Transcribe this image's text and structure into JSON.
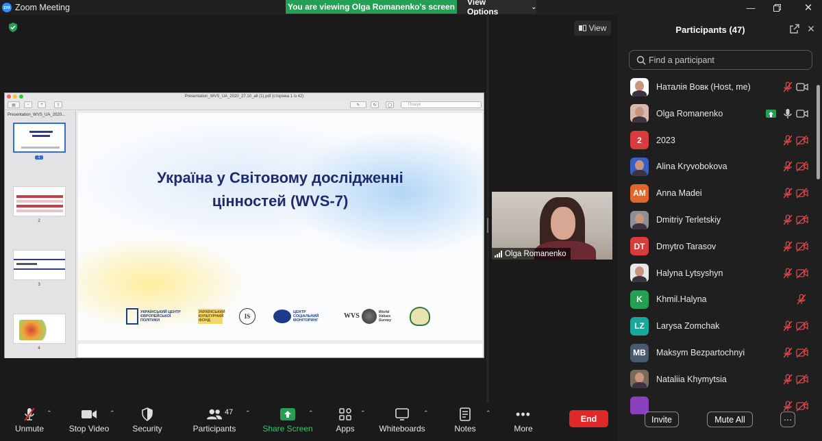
{
  "window": {
    "app_title": "Zoom Meeting",
    "logo_text": "zm",
    "banner": "You are viewing Olga Romanenko's screen",
    "view_options": "View Options"
  },
  "stage": {
    "view_button": "View",
    "video_name": "Olga Romanenko"
  },
  "shared_doc": {
    "title": "Presentation_WVS_UA_2020_27.10_all (1).pdf (сторінка 1 із 42)",
    "sidebar_title": "Presentation_WVS_UA_2020...",
    "search_placeholder": "Пошук",
    "thumbnails": [
      {
        "num": "1",
        "selected": true
      },
      {
        "num": "2",
        "selected": false
      },
      {
        "num": "3",
        "selected": false
      },
      {
        "num": "4",
        "selected": false
      }
    ],
    "slide_title_line1": "Україна у Світовому дослідженні",
    "slide_title_line2": "цінностей (WVS-7)",
    "logos": {
      "ucep": "УКРАЇНСЬКИЙ ЦЕНТР ЄВРОПЕЙСЬКОЇ ПОЛІТИКИ",
      "ukf": "УКРАЇНСЬКИЙ КУЛЬТУРНИЙ ФОНД",
      "is": "IS",
      "csm": "ЦЕНТР СОЦІАЛЬНИЙ МОНІТОРИНГ",
      "wvs_mark": "WVS",
      "wvs": "World Values Survey"
    }
  },
  "participants_panel": {
    "title": "Participants (47)",
    "search_placeholder": "Find a participant",
    "participants": [
      {
        "name": "Наталія Вовк (Host, me)",
        "initials": "",
        "avatar_color": "#ffffff",
        "photo": true,
        "mic": "muted",
        "cam": "on",
        "sharing": false
      },
      {
        "name": "Olga Romanenko",
        "initials": "",
        "avatar_color": "#d9b8b0",
        "photo": true,
        "mic": "on",
        "cam": "on",
        "sharing": true
      },
      {
        "name": "2023",
        "initials": "2",
        "avatar_color": "#d93c3c",
        "photo": false,
        "mic": "muted",
        "cam": "off",
        "sharing": false
      },
      {
        "name": "Alina Kryvobokova",
        "initials": "",
        "avatar_color": "#3a5fbf",
        "photo": true,
        "mic": "muted",
        "cam": "off",
        "sharing": false
      },
      {
        "name": "Anna Madei",
        "initials": "AM",
        "avatar_color": "#e0662a",
        "photo": false,
        "mic": "muted",
        "cam": "off",
        "sharing": false
      },
      {
        "name": "Dmitriy Terletskiy",
        "initials": "",
        "avatar_color": "#8a8f96",
        "photo": true,
        "mic": "muted",
        "cam": "off",
        "sharing": false
      },
      {
        "name": "Dmytro Tarasov",
        "initials": "DT",
        "avatar_color": "#d93c3c",
        "photo": false,
        "mic": "muted",
        "cam": "off",
        "sharing": false
      },
      {
        "name": "Halyna Lytsyshyn",
        "initials": "",
        "avatar_color": "#e8e8e8",
        "photo": true,
        "mic": "muted",
        "cam": "off",
        "sharing": false
      },
      {
        "name": "Khmil.Halyna",
        "initials": "K",
        "avatar_color": "#23a053",
        "photo": false,
        "mic": "muted",
        "cam": "none",
        "sharing": false
      },
      {
        "name": "Larysa Zomchak",
        "initials": "LZ",
        "avatar_color": "#1aa89a",
        "photo": false,
        "mic": "muted",
        "cam": "off",
        "sharing": false
      },
      {
        "name": "Maksym Bezpartochnyi",
        "initials": "MB",
        "avatar_color": "#4a5a6e",
        "photo": false,
        "mic": "muted",
        "cam": "off",
        "sharing": false
      },
      {
        "name": "Nataliia Khymytsia",
        "initials": "",
        "avatar_color": "#7a6a5a",
        "photo": true,
        "mic": "muted",
        "cam": "off",
        "sharing": false
      },
      {
        "name": "",
        "initials": "",
        "avatar_color": "#8a3fbf",
        "photo": false,
        "mic": "muted",
        "cam": "off",
        "sharing": false
      }
    ],
    "invite": "Invite",
    "mute_all": "Mute All",
    "more": "···"
  },
  "toolbar": {
    "unmute": "Unmute",
    "stop_video": "Stop Video",
    "security": "Security",
    "participants": "Participants",
    "participants_count": "47",
    "share_screen": "Share Screen",
    "apps": "Apps",
    "whiteboards": "Whiteboards",
    "notes": "Notes",
    "more": "More",
    "end": "End"
  },
  "colors": {
    "accent_green": "#23a053",
    "end_red": "#e02828",
    "muted_red": "#e0484a"
  }
}
